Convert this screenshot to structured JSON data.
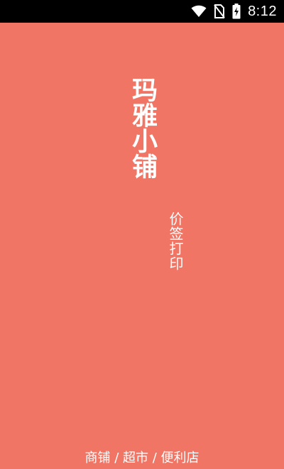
{
  "status_bar": {
    "time": "8:12",
    "icons": [
      "wifi-icon",
      "no-sim-icon",
      "battery-charging-icon"
    ]
  },
  "splash": {
    "title": "玛雅小铺",
    "subtitle": "价签打印",
    "footer": "商铺 / 超市 / 便利店"
  },
  "colors": {
    "background": "#f07565",
    "status_bar": "#000000",
    "text": "#ffffff"
  }
}
